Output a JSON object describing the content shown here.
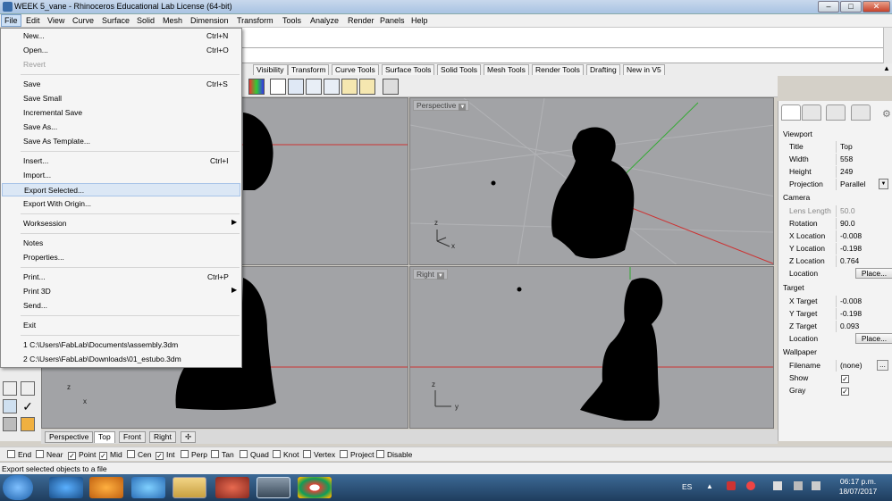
{
  "window": {
    "title": "WEEK 5_vane - Rhinoceros Educational Lab License (64-bit)"
  },
  "menubar": [
    "File",
    "Edit",
    "View",
    "Curve",
    "Surface",
    "Solid",
    "Mesh",
    "Dimension",
    "Transform",
    "Tools",
    "Analyze",
    "Render",
    "Panels",
    "Help"
  ],
  "toolbar_tabs": [
    "Visibility",
    "Transform",
    "Curve Tools",
    "Surface Tools",
    "Solid Tools",
    "Mesh Tools",
    "Render Tools",
    "Drafting",
    "New in V5"
  ],
  "file_menu": {
    "items": [
      {
        "label": "New...",
        "shortcut": "Ctrl+N"
      },
      {
        "label": "Open...",
        "shortcut": "Ctrl+O"
      },
      {
        "label": "Revert",
        "shortcut": ""
      },
      {
        "label": "Save",
        "shortcut": "Ctrl+S"
      },
      {
        "label": "Save Small",
        "shortcut": ""
      },
      {
        "label": "Incremental Save",
        "shortcut": ""
      },
      {
        "label": "Save As...",
        "shortcut": ""
      },
      {
        "label": "Save As Template...",
        "shortcut": ""
      },
      {
        "label": "Insert...",
        "shortcut": "Ctrl+I"
      },
      {
        "label": "Import...",
        "shortcut": ""
      },
      {
        "label": "Export Selected...",
        "shortcut": ""
      },
      {
        "label": "Export With Origin...",
        "shortcut": ""
      },
      {
        "label": "Worksession",
        "shortcut": ""
      },
      {
        "label": "Notes",
        "shortcut": ""
      },
      {
        "label": "Properties...",
        "shortcut": ""
      },
      {
        "label": "Print...",
        "shortcut": "Ctrl+P"
      },
      {
        "label": "Print 3D",
        "shortcut": ""
      },
      {
        "label": "Send...",
        "shortcut": ""
      },
      {
        "label": "Exit",
        "shortcut": ""
      },
      {
        "label": "1 C:\\Users\\FabLab\\Documents\\assembly.3dm",
        "shortcut": ""
      },
      {
        "label": "2 C:\\Users\\FabLab\\Downloads\\01_estubo.3dm",
        "shortcut": ""
      }
    ]
  },
  "viewports": {
    "perspective_label": "Perspective",
    "right_label": "Right",
    "axes": {
      "x": "x",
      "y": "y",
      "z": "z"
    }
  },
  "viewport_tabs": [
    "Perspective",
    "Top",
    "Front",
    "Right"
  ],
  "panel": {
    "viewport_header": "Viewport",
    "title_k": "Title",
    "title_v": "Top",
    "width_k": "Width",
    "width_v": "558",
    "height_k": "Height",
    "height_v": "249",
    "projection_k": "Projection",
    "projection_v": "Parallel",
    "camera_header": "Camera",
    "lens_k": "Lens Length",
    "lens_v": "50.0",
    "rotation_k": "Rotation",
    "rotation_v": "90.0",
    "xloc_k": "X Location",
    "xloc_v": "-0.008",
    "yloc_k": "Y Location",
    "yloc_v": "-0.198",
    "zloc_k": "Z Location",
    "zloc_v": "0.764",
    "location_k": "Location",
    "place_label": "Place...",
    "target_header": "Target",
    "xt_k": "X Target",
    "xt_v": "-0.008",
    "yt_k": "Y Target",
    "yt_v": "-0.198",
    "zt_k": "Z Target",
    "zt_v": "0.093",
    "wallpaper_header": "Wallpaper",
    "filename_k": "Filename",
    "filename_v": "(none)",
    "show_k": "Show",
    "gray_k": "Gray"
  },
  "osnaps": [
    {
      "label": "End",
      "checked": false
    },
    {
      "label": "Near",
      "checked": false
    },
    {
      "label": "Point",
      "checked": true
    },
    {
      "label": "Mid",
      "checked": true
    },
    {
      "label": "Cen",
      "checked": false
    },
    {
      "label": "Int",
      "checked": true
    },
    {
      "label": "Perp",
      "checked": false
    },
    {
      "label": "Tan",
      "checked": false
    },
    {
      "label": "Quad",
      "checked": false
    },
    {
      "label": "Knot",
      "checked": false
    },
    {
      "label": "Vertex",
      "checked": false
    },
    {
      "label": "Project",
      "checked": false
    },
    {
      "label": "Disable",
      "checked": false
    }
  ],
  "status": "Export selected objects to a file",
  "taskbar": {
    "lang": "ES",
    "time": "06:17 p.m.",
    "date": "18/07/2017"
  }
}
